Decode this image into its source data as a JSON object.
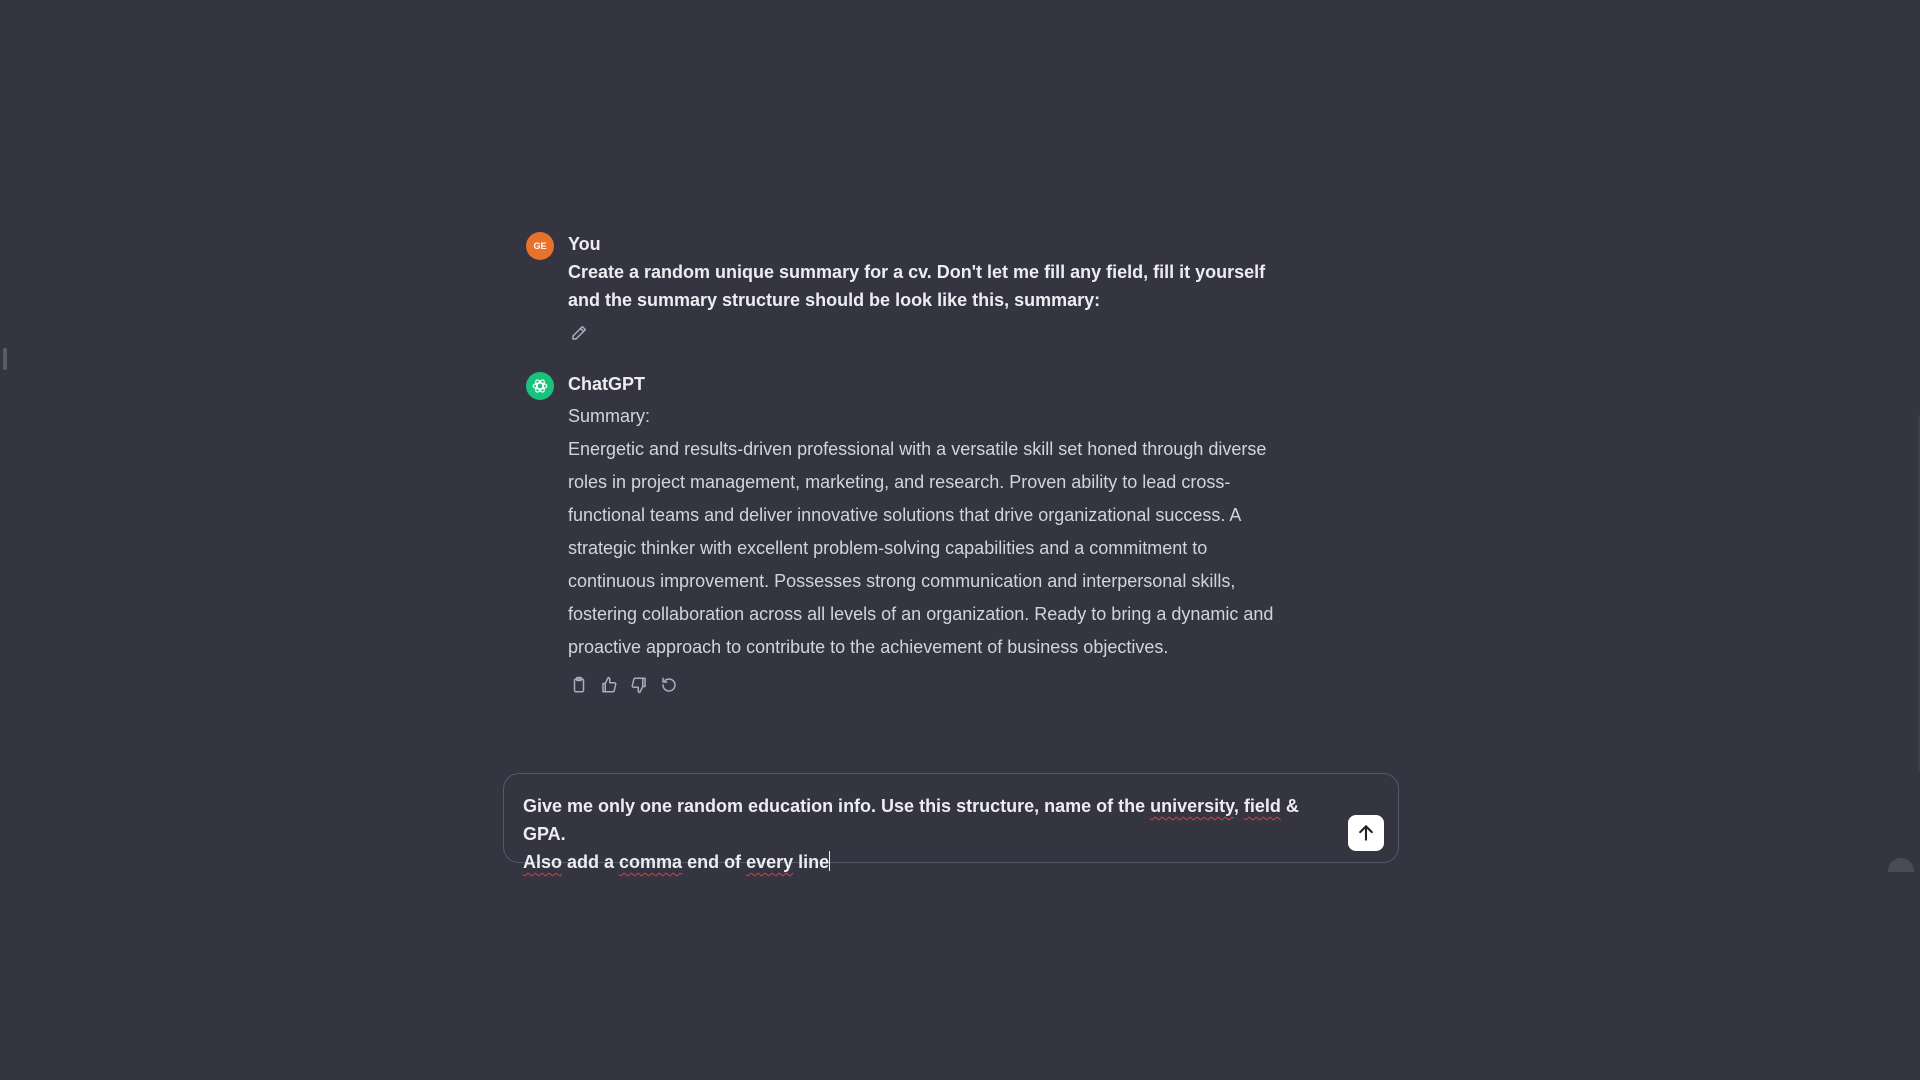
{
  "conversation": {
    "user_message": {
      "avatar_initials": "GE",
      "author": "You",
      "text": "Create a random unique summary for a cv. Don't let me fill any field, fill it yourself and the summary structure should be look like this, summary:",
      "edit_icon": "pencil-icon"
    },
    "assistant_message": {
      "avatar_icon": "openai-logo-icon",
      "author": "ChatGPT",
      "heading": "Summary:",
      "body": "Energetic and results-driven professional with a versatile skill set honed through diverse roles in project management, marketing, and research. Proven ability to lead cross-functional teams and deliver innovative solutions that drive organizational success. A strategic thinker with excellent problem-solving capabilities and a commitment to continuous improvement. Possesses strong communication and interpersonal skills, fostering collaboration across all levels of an organization. Ready to bring a dynamic and proactive approach to contribute to the achievement of business objectives.",
      "action_icons": [
        "copy-icon",
        "thumbs-up-icon",
        "thumbs-down-icon",
        "regenerate-icon"
      ]
    }
  },
  "composer": {
    "line1_parts": [
      "Give me only one random education info. Use this structure, name of the ",
      "university",
      ", ",
      "field",
      " & GPA."
    ],
    "line2_parts": [
      "Also",
      " add a ",
      "comma",
      " end of ",
      "every",
      " line"
    ],
    "send_icon": "arrow-up-icon"
  },
  "colors": {
    "background": "#343541",
    "user_avatar": "#e8722b",
    "assistant_avatar": "#19c37d",
    "text": "#ececf1",
    "secondary_text": "#d1d5db",
    "spellcheck_underline": "#e23b3b"
  }
}
